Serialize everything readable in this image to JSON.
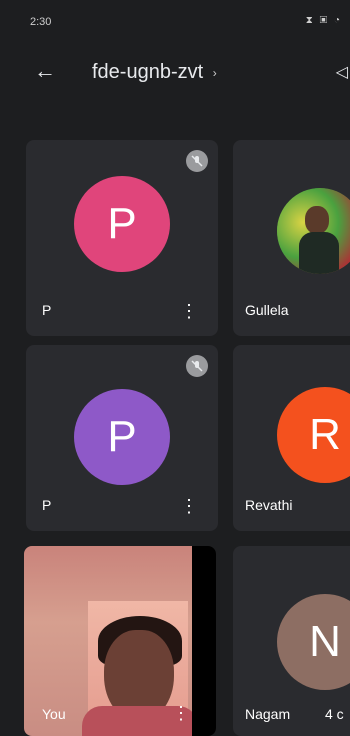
{
  "status_bar": {
    "time": "2:30",
    "icons": "⧗ ▣ ◔"
  },
  "app_bar": {
    "title": "fde-ugnb-zvt",
    "chevron": "›",
    "back_glyph": "←",
    "speaker_glyph": "◁"
  },
  "tiles": [
    {
      "name": "P",
      "avatar_letter": "P",
      "avatar_color": "#e0457b",
      "muted": true
    },
    {
      "name": "Gullela",
      "avatar_letter": "",
      "avatar_color": "",
      "muted": false
    },
    {
      "name": "P",
      "avatar_letter": "P",
      "avatar_color": "#8e59c8",
      "muted": true
    },
    {
      "name": "Revathi",
      "avatar_letter": "R",
      "avatar_color": "#f4511e",
      "muted": false
    },
    {
      "name": "You",
      "avatar_letter": "",
      "avatar_color": "",
      "muted": false
    },
    {
      "name": "Nagam",
      "avatar_letter": "N",
      "avatar_color": "#8d6e63",
      "muted": false
    }
  ],
  "more_glyph": "⋮",
  "mute_glyph": "🎙",
  "footer_count": "4 c"
}
